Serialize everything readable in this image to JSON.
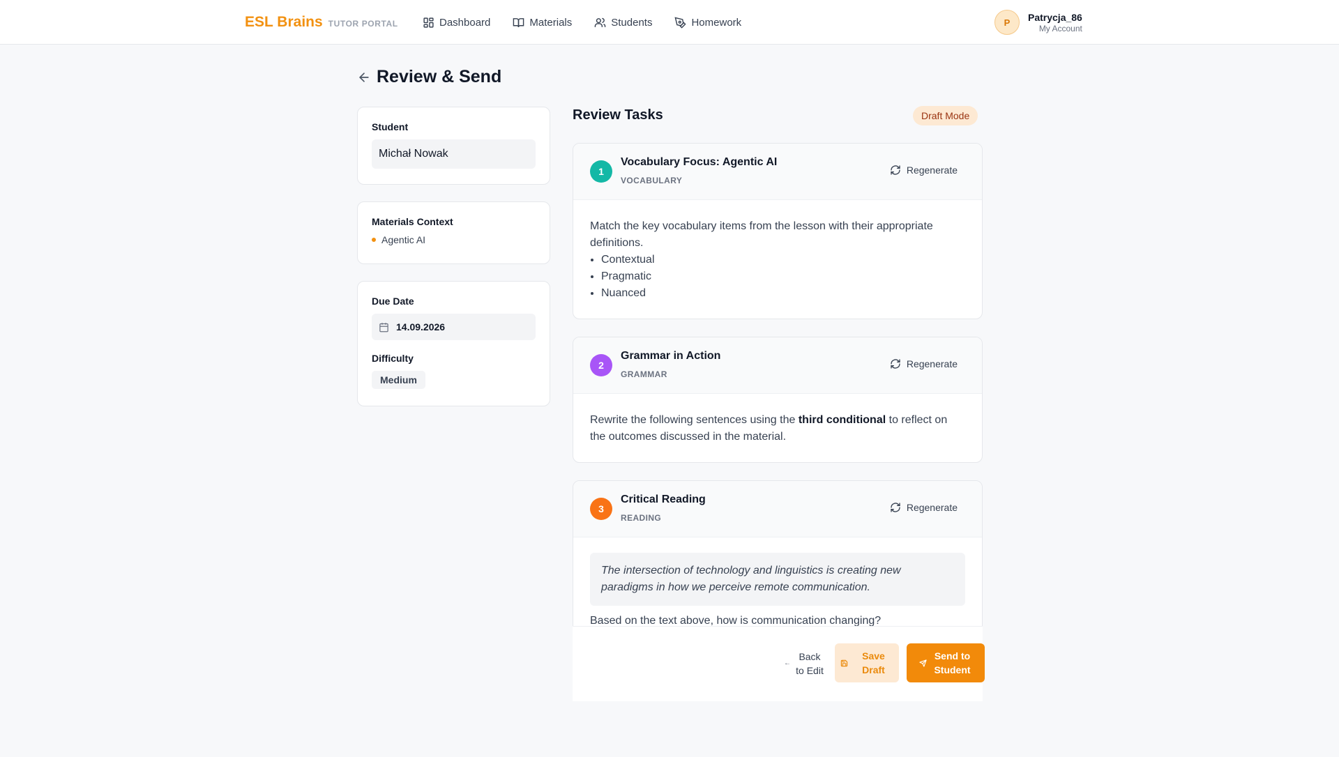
{
  "brand": {
    "name": "ESL Brains",
    "subtitle": "TUTOR PORTAL",
    "color": "#f29111"
  },
  "nav": [
    {
      "label": "Dashboard",
      "icon": "grid-icon"
    },
    {
      "label": "Materials",
      "icon": "book-open-icon"
    },
    {
      "label": "Students",
      "icon": "users-icon"
    },
    {
      "label": "Homework",
      "icon": "pen-tool-icon"
    }
  ],
  "account": {
    "initial": "P",
    "name": "Patrycja_86",
    "sub": "My Account"
  },
  "page": {
    "title": "Review & Send"
  },
  "student": {
    "label": "Student",
    "value": "Michał Nowak"
  },
  "materials": {
    "label": "Materials Context",
    "items": [
      "Agentic AI"
    ]
  },
  "due": {
    "label": "Due Date",
    "value": "14.09.2026"
  },
  "difficulty": {
    "label": "Difficulty",
    "value": "Medium"
  },
  "review": {
    "title": "Review Tasks",
    "badge": "Draft Mode"
  },
  "tasks": [
    {
      "number": "1",
      "title": "Vocabulary Focus: Agentic AI",
      "type": "VOCABULARY",
      "color": "#14b8a6",
      "regenerate": "Regenerate",
      "instruction": "Match the key vocabulary items from the lesson with their appropriate definitions.",
      "items": [
        "Contextual",
        "Pragmatic",
        "Nuanced"
      ]
    },
    {
      "number": "2",
      "title": "Grammar in Action",
      "type": "GRAMMAR",
      "color": "#a855f7",
      "regenerate": "Regenerate",
      "instruction_pre": "Rewrite the following sentences using the ",
      "instruction_bold": "third conditional",
      "instruction_post": " to reflect on the outcomes discussed in the material."
    },
    {
      "number": "3",
      "title": "Critical Reading",
      "type": "READING",
      "color": "#f97316",
      "regenerate": "Regenerate",
      "quote": "The intersection of technology and linguistics is creating new paradigms in how we perceive remote communication.",
      "question": "Based on the text above, how is communication changing?"
    }
  ],
  "actions": {
    "back": "Back to Edit",
    "draft": "Save Draft",
    "send": "Send to Student"
  }
}
